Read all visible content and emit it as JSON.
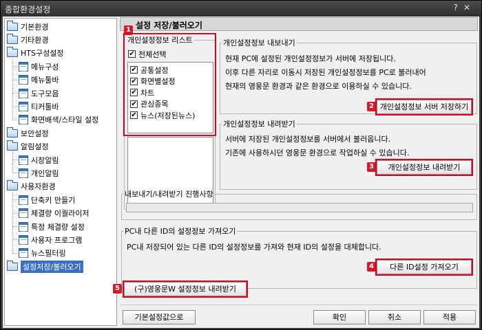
{
  "window": {
    "title": "종합환경설정",
    "help_glyph": "?",
    "close_glyph": "✕"
  },
  "tree": {
    "items": [
      {
        "label": "기본환경",
        "level": 0,
        "icon": "folder-icon"
      },
      {
        "label": "기타환경",
        "level": 0,
        "icon": "folder-icon"
      },
      {
        "label": "HTS구성설정",
        "level": 0,
        "icon": "folder-icon"
      },
      {
        "label": "메뉴구성",
        "level": 1,
        "icon": "doc-icon"
      },
      {
        "label": "메뉴툴바",
        "level": 1,
        "icon": "doc-icon"
      },
      {
        "label": "도구모음",
        "level": 1,
        "icon": "doc-icon"
      },
      {
        "label": "티커툴바",
        "level": 1,
        "icon": "doc-icon"
      },
      {
        "label": "화면배색/스타일 설정",
        "level": 1,
        "icon": "doc-icon"
      },
      {
        "label": "보안설정",
        "level": 0,
        "icon": "folder-icon"
      },
      {
        "label": "알림설정",
        "level": 0,
        "icon": "folder-icon"
      },
      {
        "label": "시장알림",
        "level": 1,
        "icon": "doc-icon"
      },
      {
        "label": "개인알림",
        "level": 1,
        "icon": "doc-icon"
      },
      {
        "label": "사용자환경",
        "level": 0,
        "icon": "folder-icon"
      },
      {
        "label": "단축키 만들기",
        "level": 1,
        "icon": "doc-icon"
      },
      {
        "label": "체결량 이퀄라이저",
        "level": 1,
        "icon": "doc-icon"
      },
      {
        "label": "특정 체결량 설정",
        "level": 1,
        "icon": "doc-icon"
      },
      {
        "label": "사용자 프로그램",
        "level": 1,
        "icon": "doc-icon"
      },
      {
        "label": "뉴스필터링",
        "level": 1,
        "icon": "doc-icon"
      },
      {
        "label": "설정저장/불러오기",
        "level": 0,
        "icon": "folder-icon",
        "selected": true
      }
    ]
  },
  "panel": {
    "title": "설정 저장/불러오기",
    "list": {
      "legend": "개인설정정보 리스트",
      "select_all": "전체선택",
      "items": [
        "공통설정",
        "화면별설정",
        "차트",
        "관심종목",
        "뉴스(저장된뉴스)"
      ]
    },
    "export": {
      "legend": "개인설정정보 내보내기",
      "line1": "현재 PC에 설정된 개인설정정보가 서버에 저장됩니다.",
      "line2": "이후 다른 자리로 이동시 저장된 개인설정정보를 PC로 불러내어",
      "line3": "현재의 영웅문 환경과 같은 환경으로 이용하실 수 있습니다.",
      "button": "개인설정정보 서버 저장하기"
    },
    "import": {
      "legend": "개인설정정보 내려받기",
      "line1": "서버에 저장된 개인설정정보를 서버에서 불러옵니다.",
      "line2": "기존에 사용하시던 영웅문 환경으로 작업하실 수 있습니다.",
      "button": "개인설정정보 내려받기"
    },
    "progress": {
      "legend": "내보내기/내려받기 진행사항"
    },
    "other_id": {
      "legend": "PC내 다른 ID의 설정정보 가져오기",
      "line1": "PC내 저장되어 있는 다른 ID의 설정정보를 가져와 현재 ID의 설정을 대체합니다.",
      "button": "다른 ID설정 가져오기"
    },
    "legacy_button": "(구)영웅문W 설정정보 내려받기",
    "badges": [
      "1",
      "2",
      "3",
      "4",
      "5"
    ]
  },
  "footer": {
    "defaults": "기본설정값으로",
    "ok": "확인",
    "cancel": "취소",
    "apply": "적용"
  },
  "colors": {
    "highlight": "#e0001b",
    "selection": "#3a6fc4",
    "badge": "#d11a2a"
  }
}
